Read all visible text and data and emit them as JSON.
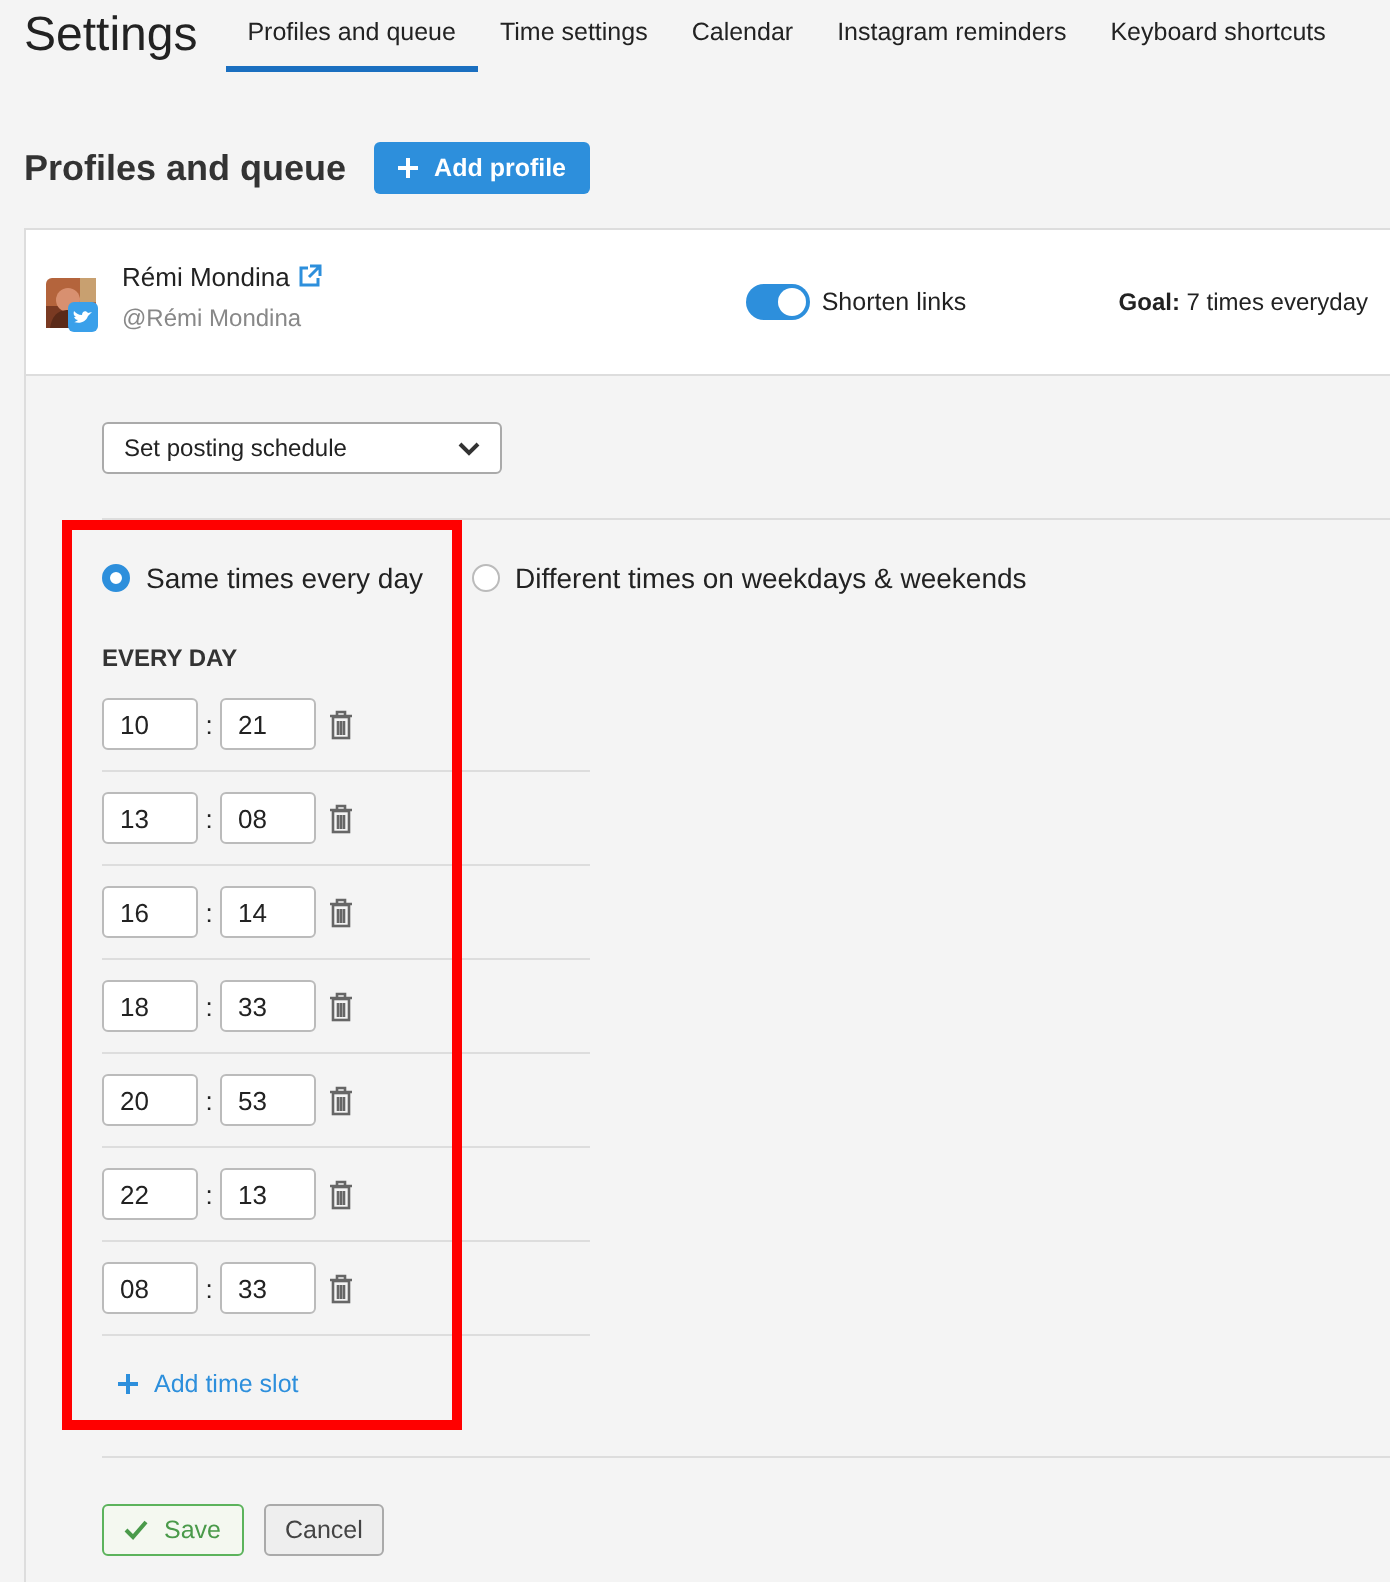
{
  "header": {
    "title": "Settings"
  },
  "tabs": [
    {
      "label": "Profiles and queue",
      "selected": true
    },
    {
      "label": "Time settings",
      "selected": false
    },
    {
      "label": "Calendar",
      "selected": false
    },
    {
      "label": "Instagram reminders",
      "selected": false
    },
    {
      "label": "Keyboard shortcuts",
      "selected": false
    }
  ],
  "section": {
    "title": "Profiles and queue",
    "add_button": "Add profile"
  },
  "profile": {
    "name": "Rémi Mondina",
    "handle": "@Rémi Mondina",
    "shorten_links": {
      "label": "Shorten links",
      "on": true
    },
    "goal": {
      "label": "Goal:",
      "value": "7 times everyday"
    }
  },
  "schedule_select": {
    "value": "Set posting schedule"
  },
  "modes": [
    {
      "label": "Same times every day",
      "selected": true
    },
    {
      "label": "Different times on weekdays & weekends",
      "selected": false
    }
  ],
  "group_title": "EVERY DAY",
  "slots": [
    {
      "hour": "10",
      "separator": ":",
      "minute": "21"
    },
    {
      "hour": "13",
      "separator": ":",
      "minute": "08"
    },
    {
      "hour": "16",
      "separator": ":",
      "minute": "14"
    },
    {
      "hour": "18",
      "separator": ":",
      "minute": "33"
    },
    {
      "hour": "20",
      "separator": ":",
      "minute": "53"
    },
    {
      "hour": "22",
      "separator": ":",
      "minute": "13"
    },
    {
      "hour": "08",
      "separator": ":",
      "minute": "33"
    }
  ],
  "add_slot": "Add time slot",
  "highlight": {
    "shown": true
  },
  "buttons": [
    {
      "kind": "save",
      "label": "Save"
    },
    {
      "kind": "cancel",
      "label": "Cancel"
    }
  ]
}
